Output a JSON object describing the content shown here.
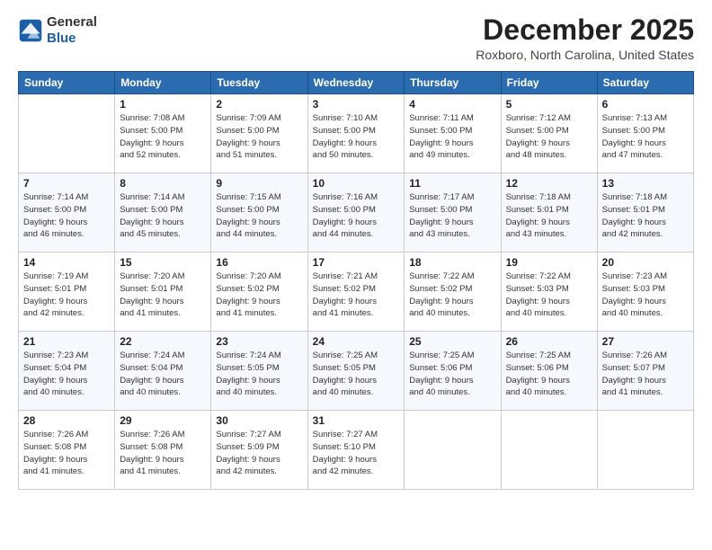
{
  "header": {
    "logo_general": "General",
    "logo_blue": "Blue",
    "month_title": "December 2025",
    "location": "Roxboro, North Carolina, United States"
  },
  "days_of_week": [
    "Sunday",
    "Monday",
    "Tuesday",
    "Wednesday",
    "Thursday",
    "Friday",
    "Saturday"
  ],
  "weeks": [
    [
      {
        "num": "",
        "info": ""
      },
      {
        "num": "1",
        "info": "Sunrise: 7:08 AM\nSunset: 5:00 PM\nDaylight: 9 hours\nand 52 minutes."
      },
      {
        "num": "2",
        "info": "Sunrise: 7:09 AM\nSunset: 5:00 PM\nDaylight: 9 hours\nand 51 minutes."
      },
      {
        "num": "3",
        "info": "Sunrise: 7:10 AM\nSunset: 5:00 PM\nDaylight: 9 hours\nand 50 minutes."
      },
      {
        "num": "4",
        "info": "Sunrise: 7:11 AM\nSunset: 5:00 PM\nDaylight: 9 hours\nand 49 minutes."
      },
      {
        "num": "5",
        "info": "Sunrise: 7:12 AM\nSunset: 5:00 PM\nDaylight: 9 hours\nand 48 minutes."
      },
      {
        "num": "6",
        "info": "Sunrise: 7:13 AM\nSunset: 5:00 PM\nDaylight: 9 hours\nand 47 minutes."
      }
    ],
    [
      {
        "num": "7",
        "info": "Sunrise: 7:14 AM\nSunset: 5:00 PM\nDaylight: 9 hours\nand 46 minutes."
      },
      {
        "num": "8",
        "info": "Sunrise: 7:14 AM\nSunset: 5:00 PM\nDaylight: 9 hours\nand 45 minutes."
      },
      {
        "num": "9",
        "info": "Sunrise: 7:15 AM\nSunset: 5:00 PM\nDaylight: 9 hours\nand 44 minutes."
      },
      {
        "num": "10",
        "info": "Sunrise: 7:16 AM\nSunset: 5:00 PM\nDaylight: 9 hours\nand 44 minutes."
      },
      {
        "num": "11",
        "info": "Sunrise: 7:17 AM\nSunset: 5:00 PM\nDaylight: 9 hours\nand 43 minutes."
      },
      {
        "num": "12",
        "info": "Sunrise: 7:18 AM\nSunset: 5:01 PM\nDaylight: 9 hours\nand 43 minutes."
      },
      {
        "num": "13",
        "info": "Sunrise: 7:18 AM\nSunset: 5:01 PM\nDaylight: 9 hours\nand 42 minutes."
      }
    ],
    [
      {
        "num": "14",
        "info": "Sunrise: 7:19 AM\nSunset: 5:01 PM\nDaylight: 9 hours\nand 42 minutes."
      },
      {
        "num": "15",
        "info": "Sunrise: 7:20 AM\nSunset: 5:01 PM\nDaylight: 9 hours\nand 41 minutes."
      },
      {
        "num": "16",
        "info": "Sunrise: 7:20 AM\nSunset: 5:02 PM\nDaylight: 9 hours\nand 41 minutes."
      },
      {
        "num": "17",
        "info": "Sunrise: 7:21 AM\nSunset: 5:02 PM\nDaylight: 9 hours\nand 41 minutes."
      },
      {
        "num": "18",
        "info": "Sunrise: 7:22 AM\nSunset: 5:02 PM\nDaylight: 9 hours\nand 40 minutes."
      },
      {
        "num": "19",
        "info": "Sunrise: 7:22 AM\nSunset: 5:03 PM\nDaylight: 9 hours\nand 40 minutes."
      },
      {
        "num": "20",
        "info": "Sunrise: 7:23 AM\nSunset: 5:03 PM\nDaylight: 9 hours\nand 40 minutes."
      }
    ],
    [
      {
        "num": "21",
        "info": "Sunrise: 7:23 AM\nSunset: 5:04 PM\nDaylight: 9 hours\nand 40 minutes."
      },
      {
        "num": "22",
        "info": "Sunrise: 7:24 AM\nSunset: 5:04 PM\nDaylight: 9 hours\nand 40 minutes."
      },
      {
        "num": "23",
        "info": "Sunrise: 7:24 AM\nSunset: 5:05 PM\nDaylight: 9 hours\nand 40 minutes."
      },
      {
        "num": "24",
        "info": "Sunrise: 7:25 AM\nSunset: 5:05 PM\nDaylight: 9 hours\nand 40 minutes."
      },
      {
        "num": "25",
        "info": "Sunrise: 7:25 AM\nSunset: 5:06 PM\nDaylight: 9 hours\nand 40 minutes."
      },
      {
        "num": "26",
        "info": "Sunrise: 7:25 AM\nSunset: 5:06 PM\nDaylight: 9 hours\nand 40 minutes."
      },
      {
        "num": "27",
        "info": "Sunrise: 7:26 AM\nSunset: 5:07 PM\nDaylight: 9 hours\nand 41 minutes."
      }
    ],
    [
      {
        "num": "28",
        "info": "Sunrise: 7:26 AM\nSunset: 5:08 PM\nDaylight: 9 hours\nand 41 minutes."
      },
      {
        "num": "29",
        "info": "Sunrise: 7:26 AM\nSunset: 5:08 PM\nDaylight: 9 hours\nand 41 minutes."
      },
      {
        "num": "30",
        "info": "Sunrise: 7:27 AM\nSunset: 5:09 PM\nDaylight: 9 hours\nand 42 minutes."
      },
      {
        "num": "31",
        "info": "Sunrise: 7:27 AM\nSunset: 5:10 PM\nDaylight: 9 hours\nand 42 minutes."
      },
      {
        "num": "",
        "info": ""
      },
      {
        "num": "",
        "info": ""
      },
      {
        "num": "",
        "info": ""
      }
    ]
  ]
}
